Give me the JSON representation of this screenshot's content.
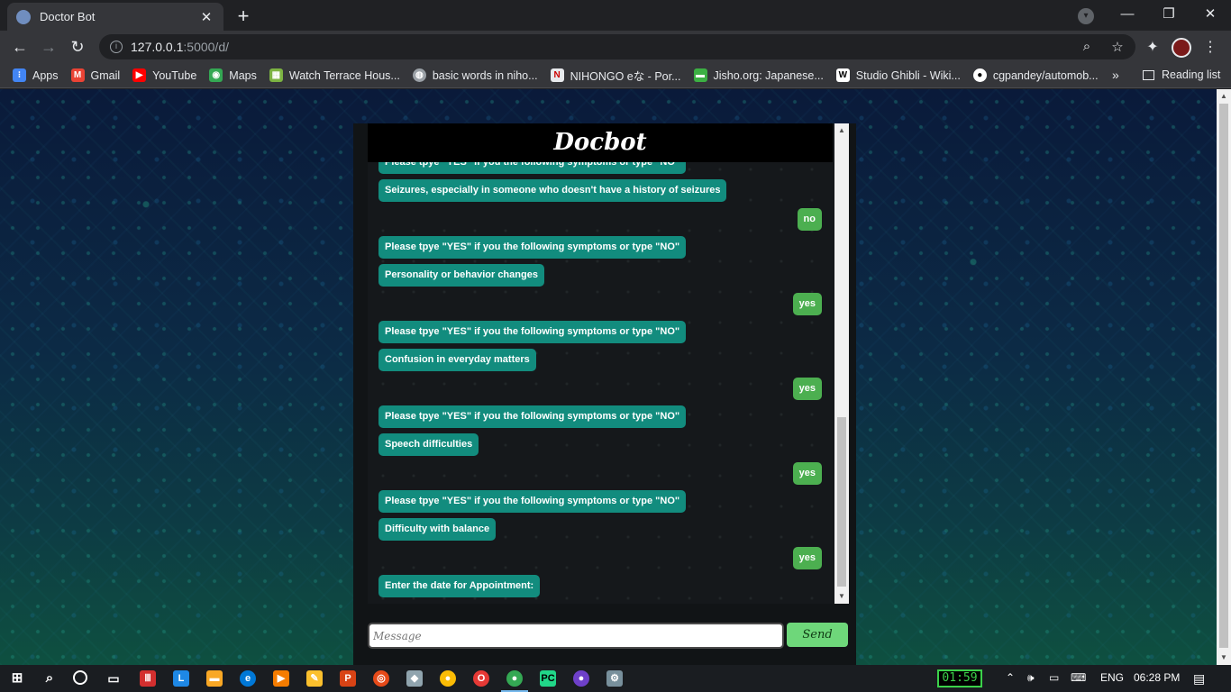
{
  "browser": {
    "tab_title": "Doctor Bot",
    "tab_close": "✕",
    "new_tab": "+",
    "url_host": "127.0.0.1",
    "url_rest": ":5000/d/",
    "window_controls": {
      "minimize": "—",
      "restore": "❐",
      "close": "✕"
    }
  },
  "bookmarks": {
    "items": [
      {
        "label": "Apps",
        "icon": "apps-icon",
        "color": "#4285f4"
      },
      {
        "label": "Gmail",
        "icon": "gmail-icon",
        "color": "#ea4335"
      },
      {
        "label": "YouTube",
        "icon": "youtube-icon",
        "color": "#ff0000"
      },
      {
        "label": "Maps",
        "icon": "maps-icon",
        "color": "#34a853"
      },
      {
        "label": "Watch Terrace Hous...",
        "icon": "site-icon",
        "color": "#7cb342"
      },
      {
        "label": "basic words in niho...",
        "icon": "globe-icon",
        "color": "#9aa0a6"
      },
      {
        "label": "NIHONGO eな - Por...",
        "icon": "site-icon",
        "color": "#e8eaed"
      },
      {
        "label": "Jisho.org: Japanese...",
        "icon": "site-icon",
        "color": "#3cb043"
      },
      {
        "label": "Studio Ghibli - Wiki...",
        "icon": "wikipedia-icon",
        "color": "#ffffff"
      },
      {
        "label": "cgpandey/automob...",
        "icon": "github-icon",
        "color": "#ffffff"
      }
    ],
    "more": "»",
    "reading_list": "Reading list"
  },
  "chat": {
    "title": "Docbot",
    "messages": [
      {
        "from": "bot",
        "text": "Please tpye \"YES\" if you the following symptoms or type \"NO\""
      },
      {
        "from": "bot",
        "text": "Seizures, especially in someone who doesn't have a history of seizures"
      },
      {
        "from": "user",
        "text": "no"
      },
      {
        "from": "bot",
        "text": "Please tpye \"YES\" if you the following symptoms or type \"NO\""
      },
      {
        "from": "bot",
        "text": "Personality or behavior changes"
      },
      {
        "from": "user",
        "text": "yes"
      },
      {
        "from": "bot",
        "text": "Please tpye \"YES\" if you the following symptoms or type \"NO\""
      },
      {
        "from": "bot",
        "text": "Confusion in everyday matters"
      },
      {
        "from": "user",
        "text": "yes"
      },
      {
        "from": "bot",
        "text": "Please tpye \"YES\" if you the following symptoms or type \"NO\""
      },
      {
        "from": "bot",
        "text": "Speech difficulties"
      },
      {
        "from": "user",
        "text": "yes"
      },
      {
        "from": "bot",
        "text": "Please tpye \"YES\" if you the following symptoms or type \"NO\""
      },
      {
        "from": "bot",
        "text": "Difficulty with balance"
      },
      {
        "from": "user",
        "text": "yes"
      },
      {
        "from": "bot",
        "text": "Enter the date for Appointment:"
      }
    ],
    "input_placeholder": "Message",
    "input_value": "",
    "send_label": "Send",
    "bot_bubble_color": "#128c7e",
    "user_bubble_color": "#4caf50"
  },
  "taskbar": {
    "timer": "01:59",
    "language": "ENG",
    "time": "06:28 PM"
  }
}
